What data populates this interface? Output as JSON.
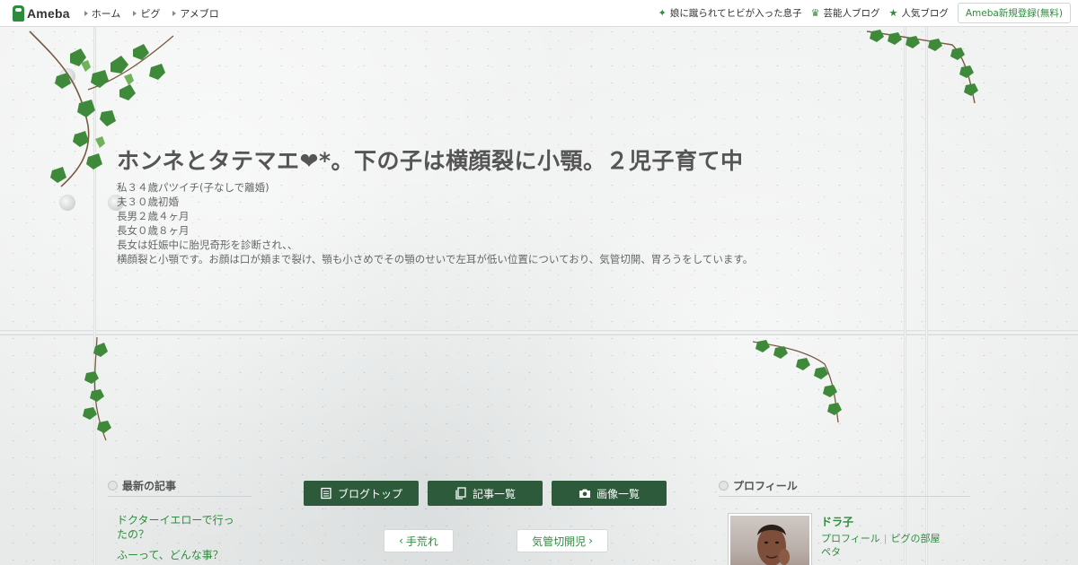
{
  "topbar": {
    "logo_text": "Ameba",
    "nav": [
      "ホーム",
      "ピグ",
      "アメブロ"
    ],
    "right_links": [
      {
        "label": "娘に蹴られてヒビが入った息子",
        "icon": "sparkle-icon"
      },
      {
        "label": "芸能人ブログ",
        "icon": "crown-icon"
      },
      {
        "label": "人気ブログ",
        "icon": "star-icon"
      }
    ],
    "register_label": "Ameba新規登録(無料)"
  },
  "header": {
    "title": "ホンネとタテマエ❤*。下の子は横顔裂に小顎。２児子育て中",
    "description": [
      "私３４歳パツイチ(子なしで離婚)",
      "夫３０歳初婚",
      "長男２歳４ヶ月",
      "長女０歳８ヶ月",
      "長女は妊娠中に胎児奇形を診断され、、",
      "横顔裂と小顎です。お顔は口が頬まで裂け、顎も小さめでその顎のせいで左耳が低い位置についており、気管切開、胃ろうをしています。"
    ]
  },
  "sidebar_left": {
    "heading": "最新の記事",
    "items": [
      "ドクターイエローで行ったの？",
      "ふーって、どんな事？"
    ]
  },
  "main": {
    "buttons": [
      {
        "label": "ブログトップ",
        "icon": "document-icon"
      },
      {
        "label": "記事一覧",
        "icon": "copy-icon"
      },
      {
        "label": "画像一覧",
        "icon": "camera-icon"
      }
    ],
    "prev_label": "手荒れ",
    "next_label": "気管切開児"
  },
  "sidebar_right": {
    "heading": "プロフィール",
    "name": "ドラ子",
    "link_profile": "プロフィール",
    "link_room": "ピグの部屋",
    "link_peta": "ペタ"
  },
  "colors": {
    "accent": "#2d8c3c",
    "button_dark": "#2c5a3a",
    "title_gray": "#555555"
  }
}
